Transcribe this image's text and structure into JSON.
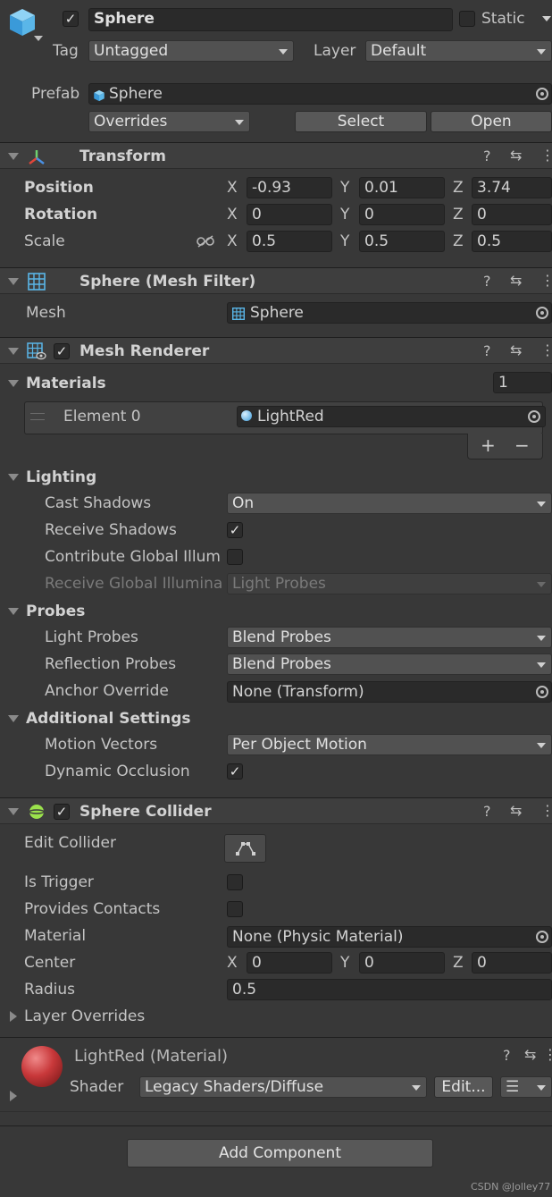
{
  "object": {
    "name": "Sphere",
    "static_label": "Static",
    "tag_label": "Tag",
    "tag_value": "Untagged",
    "layer_label": "Layer",
    "layer_value": "Default",
    "prefab_label": "Prefab",
    "prefab_value": "Sphere",
    "overrides_label": "Overrides",
    "select_label": "Select",
    "open_label": "Open"
  },
  "transform": {
    "title": "Transform",
    "position_label": "Position",
    "rotation_label": "Rotation",
    "scale_label": "Scale",
    "x_axis": "X",
    "y_axis": "Y",
    "z_axis": "Z",
    "position": {
      "x": "-0.93",
      "y": "0.01",
      "z": "3.74"
    },
    "rotation": {
      "x": "0",
      "y": "0",
      "z": "0"
    },
    "scale": {
      "x": "0.5",
      "y": "0.5",
      "z": "0.5"
    }
  },
  "mesh_filter": {
    "title": "Sphere (Mesh Filter)",
    "mesh_label": "Mesh",
    "mesh_value": "Sphere"
  },
  "mesh_renderer": {
    "title": "Mesh Renderer",
    "materials_label": "Materials",
    "materials_count": "1",
    "element_label": "Element 0",
    "element_value": "LightRed",
    "plus": "+",
    "minus": "−",
    "lighting_label": "Lighting",
    "cast_shadows_label": "Cast Shadows",
    "cast_shadows_value": "On",
    "receive_shadows_label": "Receive Shadows",
    "contribute_gi_label": "Contribute Global Illum",
    "receive_gi_label": "Receive Global Illumina",
    "receive_gi_value": "Light Probes",
    "probes_label": "Probes",
    "light_probes_label": "Light Probes",
    "light_probes_value": "Blend Probes",
    "reflection_probes_label": "Reflection Probes",
    "reflection_probes_value": "Blend Probes",
    "anchor_override_label": "Anchor Override",
    "anchor_override_value": "None (Transform)",
    "additional_label": "Additional Settings",
    "motion_vectors_label": "Motion Vectors",
    "motion_vectors_value": "Per Object Motion",
    "dynamic_occlusion_label": "Dynamic Occlusion"
  },
  "sphere_collider": {
    "title": "Sphere Collider",
    "edit_collider_label": "Edit Collider",
    "is_trigger_label": "Is Trigger",
    "provides_contacts_label": "Provides Contacts",
    "material_label": "Material",
    "material_value": "None (Physic Material)",
    "center_label": "Center",
    "center": {
      "x": "0",
      "y": "0",
      "z": "0"
    },
    "radius_label": "Radius",
    "radius_value": "0.5",
    "layer_overrides_label": "Layer Overrides"
  },
  "material": {
    "title": "LightRed (Material)",
    "shader_label": "Shader",
    "shader_value": "Legacy Shaders/Diffuse",
    "edit_label": "Edit..."
  },
  "add_component_label": "Add Component",
  "watermark": "CSDN @Jolley77",
  "colors": {
    "background": "#383838",
    "header": "#3e3e3e",
    "field": "#2a2a2a",
    "dropdown": "#515151",
    "material_sphere": "#c8383a"
  }
}
